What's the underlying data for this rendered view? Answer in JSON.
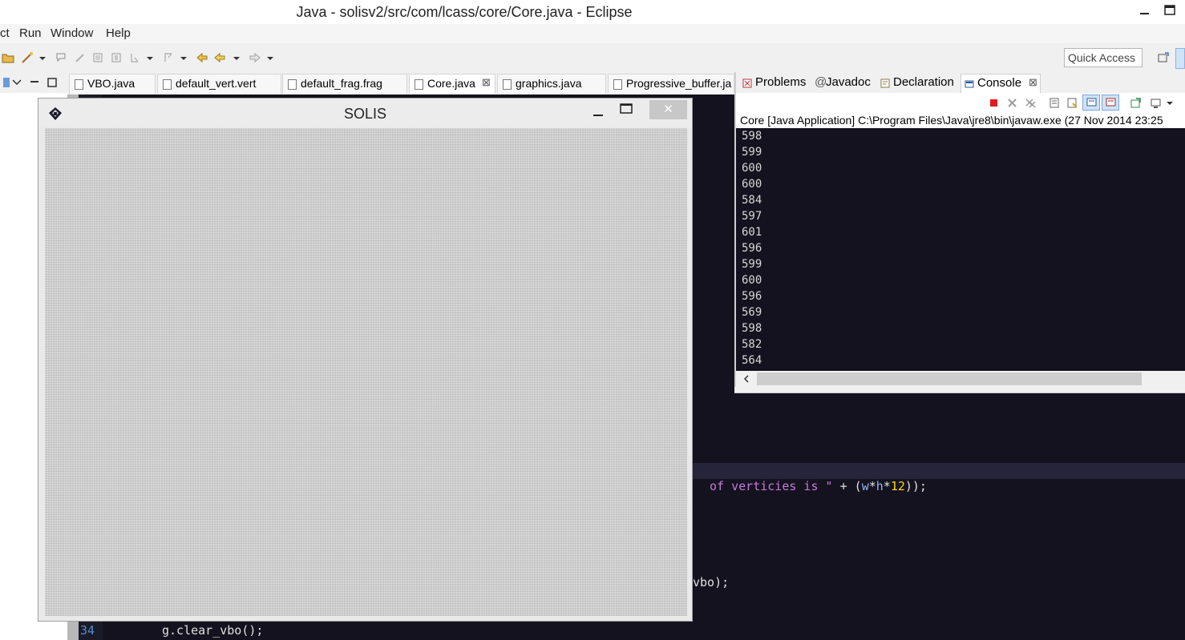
{
  "window": {
    "title": "Java - solisv2/src/com/lcass/core/Core.java - Eclipse"
  },
  "menu": {
    "items": [
      "ct",
      "Run",
      "Window",
      "Help"
    ]
  },
  "toolbar": {
    "quick_access_placeholder": "Quick Access"
  },
  "editor": {
    "tabs": [
      {
        "label": "VBO.java",
        "active": false
      },
      {
        "label": "default_vert.vert",
        "active": false
      },
      {
        "label": "default_frag.frag",
        "active": false
      },
      {
        "label": "Core.java",
        "active": true,
        "close": "⊠"
      },
      {
        "label": "graphics.java",
        "active": false
      },
      {
        "label": "Progressive_buffer.ja",
        "active": false
      }
    ],
    "code": {
      "line_a_string": " of verticies is \" ",
      "line_a_op": "+ (",
      "line_a_w": "w",
      "line_a_star": "*",
      "line_a_h": "h",
      "line_a_star2": "*",
      "line_a_num": "12",
      "line_a_end": "));",
      "line_b": "vbo);",
      "line_number": "34",
      "line_c": "g.clear_vbo();"
    }
  },
  "panel": {
    "tabs": [
      {
        "label": "Problems"
      },
      {
        "label": "Javadoc",
        "prefix": "@"
      },
      {
        "label": "Declaration"
      },
      {
        "label": "Console",
        "active": true,
        "close": "⊠"
      }
    ],
    "console_description": "Core [Java Application] C:\\Program Files\\Java\\jre8\\bin\\javaw.exe (27 Nov 2014 23:25",
    "console_lines": [
      "598",
      "599",
      "600",
      "600",
      "584",
      "597",
      "601",
      "596",
      "599",
      "600",
      "596",
      "569",
      "598",
      "582",
      "564"
    ]
  },
  "solis": {
    "title": "SOLIS",
    "close_glyph": "✕"
  },
  "colors": {
    "editor_bg": "#13121e",
    "string_purple": "#c678dd",
    "number_yellow": "#ffd700",
    "identifier_blue": "#8fb8ff",
    "terminate_red": "#e01b1b"
  }
}
